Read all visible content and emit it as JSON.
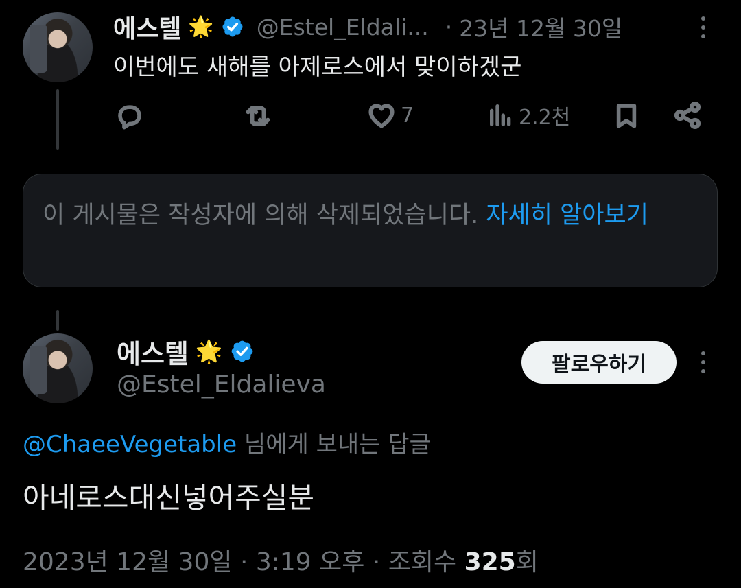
{
  "parent_tweet": {
    "display_name": "에스텔",
    "badge_emoji": "🌟",
    "handle": "@Estel_Eldali...",
    "separator": "·",
    "date": "23년 12월 30일",
    "text": "이번에도 새해를 아제로스에서 맞이하겠군",
    "likes": "7",
    "views": "2.2천"
  },
  "deleted_notice": {
    "text": "이 게시물은 작성자에 의해 삭제되었습니다.",
    "link": "자세히 알아보기"
  },
  "main_tweet": {
    "display_name": "에스텔",
    "badge_emoji": "🌟",
    "handle": "@Estel_Eldalieva",
    "follow_label": "팔로우하기",
    "reply_to_handle": "@ChaeeVegetable",
    "reply_to_suffix": "님에게 보내는 답글",
    "text": "아네로스대신넣어주실분",
    "date": "2023년 12월 30일",
    "sep1": "·",
    "time": "3:19 오후",
    "sep2": "·",
    "views_label": "조회수",
    "views_count": "325",
    "views_suffix": "회"
  },
  "colors": {
    "background": "#000000",
    "text": "#e7e9ea",
    "secondary": "#71767b",
    "accent": "#1d9bf0",
    "card": "#16181c"
  },
  "icons": [
    "reply-icon",
    "retweet-icon",
    "heart-icon",
    "views-icon",
    "bookmark-icon",
    "share-icon",
    "more-icon",
    "verified-icon"
  ]
}
